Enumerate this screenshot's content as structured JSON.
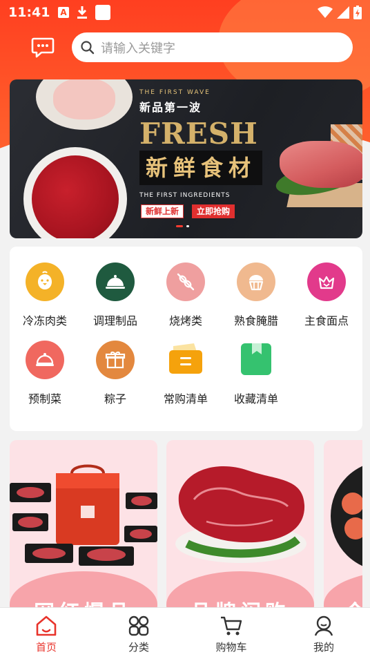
{
  "status_bar": {
    "time": "11:41",
    "notif_icon_letter": "A",
    "icons_left": [
      "a-badge-icon",
      "download-icon",
      "app-square-icon"
    ],
    "icons_right": [
      "wifi-icon",
      "cellular-signal-icon",
      "battery-charging-icon"
    ]
  },
  "header": {
    "gradient_top": "#ff3f20",
    "gradient_bottom": "#ff6a36",
    "message_icon": "chat-bubble-icon",
    "search_placeholder": "请输入关键字"
  },
  "banner": {
    "top_en": "THE FIRST WAVE",
    "subtitle": "新品第一波",
    "headline": "FRESH",
    "headline_cn": "新鲜食材",
    "tagline_en": "THE FIRST INGREDIENTS",
    "tag_new": "新鲜上新",
    "tag_buy": "立即抢购",
    "page_count": 2,
    "active_index": 0
  },
  "categories": [
    {
      "label": "冷冻肉类",
      "icon": "chicken-icon",
      "color": "#f4b228"
    },
    {
      "label": "调理制品",
      "icon": "cloche-icon",
      "color": "#1f5a3f"
    },
    {
      "label": "烧烤类",
      "icon": "skewer-icon",
      "color": "#ef9f9f"
    },
    {
      "label": "熟食腌腊",
      "icon": "muffin-icon",
      "color": "#f0b98f"
    },
    {
      "label": "主食面点",
      "icon": "crown-icon",
      "color": "#e23a8b"
    },
    {
      "label": "预制菜",
      "icon": "cloche-icon",
      "color": "#f0685f"
    },
    {
      "label": "粽子",
      "icon": "gift-icon",
      "color": "#e3883e"
    },
    {
      "label": "常购清单",
      "icon": "ticket-icon",
      "color": "#f5a20c"
    },
    {
      "label": "收藏清单",
      "icon": "bookmark-icon",
      "color": "#35c26f"
    }
  ],
  "cards": [
    {
      "title": "网红爆品",
      "image": "delivery-bag-meat-trays"
    },
    {
      "title": "品牌闪购",
      "image": "beef-steak-plate"
    },
    {
      "title": "今",
      "image": "sausage-pan"
    }
  ],
  "tabbar": [
    {
      "label": "首页",
      "icon": "home-icon",
      "active": true
    },
    {
      "label": "分类",
      "icon": "grid-icon",
      "active": false
    },
    {
      "label": "购物车",
      "icon": "cart-icon",
      "active": false
    },
    {
      "label": "我的",
      "icon": "user-icon",
      "active": false
    }
  ],
  "colors": {
    "accent": "#ff3b30",
    "active_tab": "#e8332b",
    "tab_text": "#333333"
  }
}
